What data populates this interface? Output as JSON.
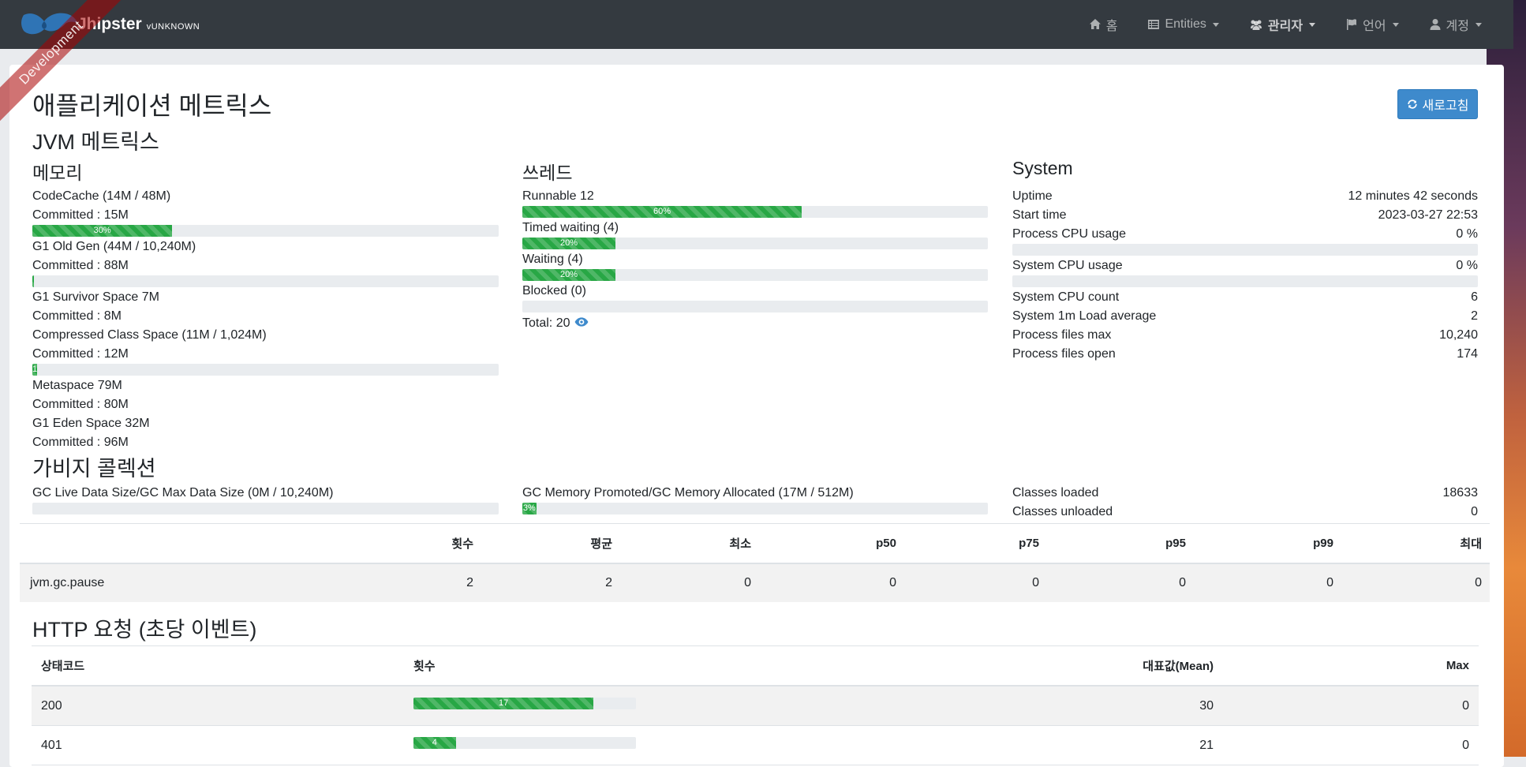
{
  "navbar": {
    "ribbon": "Development",
    "brand_name": "Jhipster",
    "brand_version": "vUNKNOWN",
    "items": [
      {
        "label": "홈",
        "icon": "home-icon"
      },
      {
        "label": "Entities",
        "icon": "list-icon"
      },
      {
        "label": "관리자",
        "icon": "users-icon"
      },
      {
        "label": "언어",
        "icon": "flag-icon"
      },
      {
        "label": "계정",
        "icon": "user-icon"
      }
    ]
  },
  "page": {
    "title": "애플리케이션 메트릭스",
    "refresh_label": "새로고침",
    "jvm_title": "JVM 메트릭스"
  },
  "memory": {
    "title": "메모리",
    "items": [
      {
        "label": "CodeCache (14M / 48M)",
        "committed": "Committed : 15M",
        "percent": 30,
        "bar_label": "30%"
      },
      {
        "label": "G1 Old Gen (44M / 10,240M)",
        "committed": "Committed : 88M",
        "percent": 0.4,
        "bar_label": ""
      },
      {
        "label": "G1 Survivor Space 7M",
        "committed": "Committed : 8M"
      },
      {
        "label": "Compressed Class Space (11M / 1,024M)",
        "committed": "Committed : 12M",
        "percent": 1,
        "bar_label": "1"
      },
      {
        "label": "Metaspace 79M",
        "committed": "Committed : 80M"
      },
      {
        "label": "G1 Eden Space 32M",
        "committed": "Committed : 96M"
      }
    ]
  },
  "threads": {
    "title": "쓰레드",
    "items": [
      {
        "label": "Runnable 12",
        "percent": 60,
        "bar_label": "60%"
      },
      {
        "label": "Timed waiting (4)",
        "percent": 20,
        "bar_label": "20%"
      },
      {
        "label": "Waiting (4)",
        "percent": 20,
        "bar_label": "20%"
      },
      {
        "label": "Blocked (0)",
        "percent": 0,
        "bar_label": ""
      }
    ],
    "total": "Total: 20"
  },
  "system": {
    "title": "System",
    "uptime_label": "Uptime",
    "uptime_value": "12 minutes 42 seconds",
    "start_label": "Start time",
    "start_value": "2023-03-27 22:53",
    "pcpu_label": "Process CPU usage",
    "pcpu_value": "0 %",
    "pcpu_percent": 0,
    "scpu_label": "System CPU usage",
    "scpu_value": "0 %",
    "scpu_percent": 0,
    "count_label": "System CPU count",
    "count_value": "6",
    "load_label": "System 1m Load average",
    "load_value": "2",
    "fmax_label": "Process files max",
    "fmax_value": "10,240",
    "fopen_label": "Process files open",
    "fopen_value": "174"
  },
  "gc": {
    "title": "가비지 콜렉션",
    "live_label": "GC Live Data Size/GC Max Data Size (0M / 10,240M)",
    "live_percent": 0,
    "promoted_label": "GC Memory Promoted/GC Memory Allocated (17M / 512M)",
    "promoted_percent": 3,
    "promoted_bar": "3%",
    "classes_loaded_label": "Classes loaded",
    "classes_loaded_value": "18633",
    "classes_unloaded_label": "Classes unloaded",
    "classes_unloaded_value": "0",
    "table_headers": [
      "횟수",
      "평균",
      "최소",
      "p50",
      "p75",
      "p95",
      "p99",
      "최대"
    ],
    "row": {
      "name": "jvm.gc.pause",
      "values": [
        "2",
        "2",
        "0",
        "0",
        "0",
        "0",
        "0",
        "0"
      ]
    }
  },
  "http": {
    "title": "HTTP 요청 (초당 이벤트)",
    "headers": {
      "code": "상태코드",
      "count": "횟수",
      "mean": "대표값(Mean)",
      "max": "Max"
    },
    "rows": [
      {
        "code": "200",
        "count": 17,
        "count_label": "17",
        "mean": "30",
        "max": "0"
      },
      {
        "code": "401",
        "count": 4,
        "count_label": "4",
        "mean": "21",
        "max": "0"
      }
    ],
    "count_max": 21
  }
}
